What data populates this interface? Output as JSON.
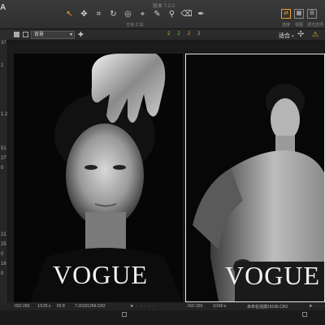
{
  "app": {
    "logo": "A",
    "version": "版本 7.2.0",
    "tools_label": "光标工具",
    "tools": [
      "pointer-icon",
      "pan-icon",
      "crop-icon",
      "rotate-icon",
      "spot-icon",
      "picker-icon",
      "brush-icon",
      "stamp-icon",
      "eraser-icon",
      "pen-icon"
    ],
    "right_labels": [
      "连接",
      "视图",
      "调光选项"
    ]
  },
  "subbar": {
    "background_select": "背景",
    "counters": [
      "2",
      "2",
      "2",
      "2"
    ],
    "fit_label": "适合"
  },
  "left_panel": {
    "values": [
      "37",
      "1",
      "1.2",
      "51",
      "27",
      "0",
      "21",
      "25",
      "0",
      "16",
      "0"
    ]
  },
  "photos": [
    {
      "masthead": "VOGUE",
      "iso": "ISO 200",
      "shutter": "1/125 s",
      "aperture": "f/2.8",
      "filename": "7.20191266.CR2",
      "rating": "★ · · · · ·"
    },
    {
      "masthead": "VOGUE",
      "iso": "ISO 320",
      "shutter": "1/160 s",
      "filename": "未命名拍摄19195.CR2",
      "rating": "★ · · · · ·"
    }
  ],
  "colors": {
    "accent": "#f0a030",
    "background": "#1e1e1e"
  }
}
